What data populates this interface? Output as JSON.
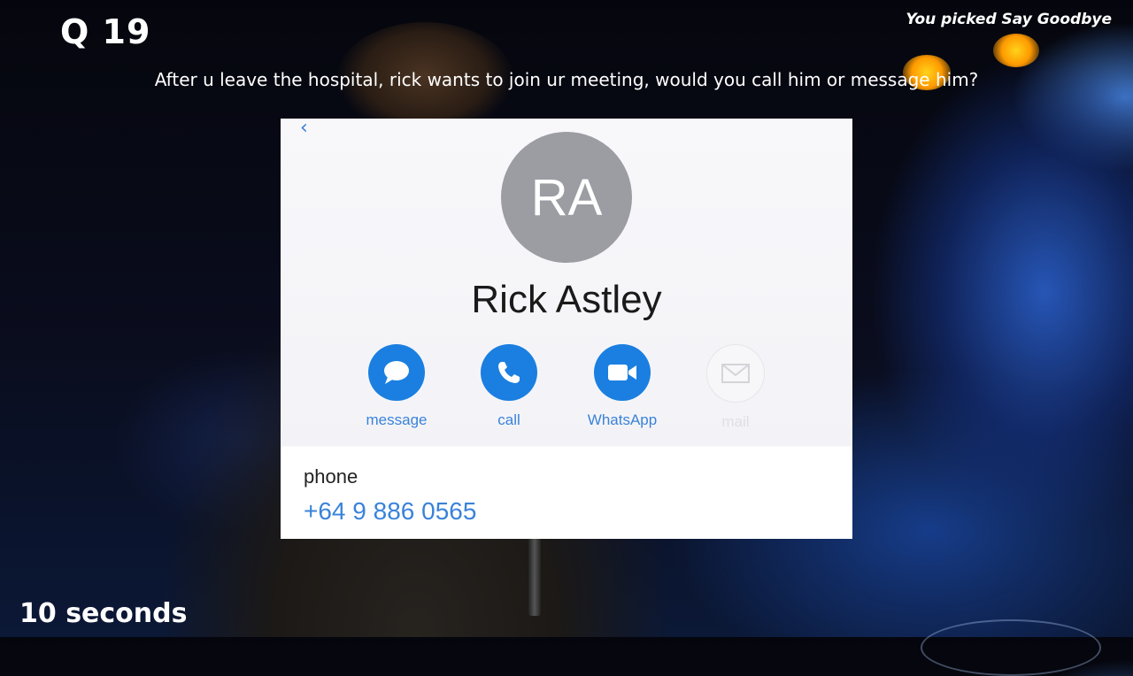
{
  "header": {
    "question_number": "Q 19",
    "picked_text": "You picked Say Goodbye"
  },
  "question": "After u leave the hospital, rick wants to join ur meeting, would you call him or message him?",
  "contact": {
    "initials": "RA",
    "name": "Rick Astley",
    "actions": [
      {
        "label": "message",
        "icon": "message-bubble-icon",
        "enabled": true
      },
      {
        "label": "call",
        "icon": "phone-icon",
        "enabled": true
      },
      {
        "label": "WhatsApp",
        "icon": "video-camera-icon",
        "enabled": true
      },
      {
        "label": "mail",
        "icon": "envelope-icon",
        "enabled": false
      }
    ],
    "phone_label": "phone",
    "phone_number": "+64 9 886 0565"
  },
  "timer": "10 seconds",
  "colors": {
    "accent": "#1a7fe0",
    "link": "#3a83d9",
    "avatar": "#9c9da3"
  }
}
